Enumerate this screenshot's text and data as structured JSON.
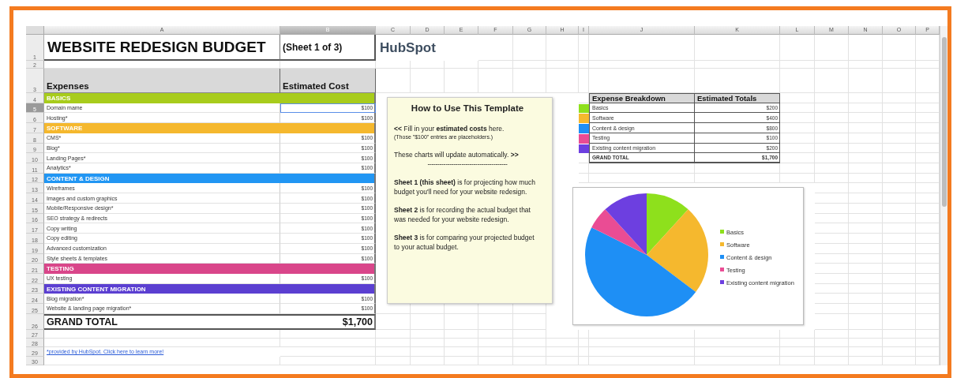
{
  "columns": [
    "A",
    "B",
    "C",
    "D",
    "E",
    "F",
    "G",
    "H",
    "I",
    "J",
    "K",
    "L",
    "M",
    "N",
    "O",
    "P"
  ],
  "row_numbers": [
    "1",
    "2",
    "3",
    "4",
    "5",
    "6",
    "7",
    "8",
    "9",
    "10",
    "11",
    "12",
    "13",
    "14",
    "15",
    "16",
    "17",
    "18",
    "19",
    "20",
    "21",
    "22",
    "23",
    "24",
    "25",
    "26",
    "27",
    "28",
    "29",
    "30"
  ],
  "title": "WEBSITE REDESIGN BUDGET",
  "sheet_label": "(Sheet 1 of 3)",
  "logo": "HubSpot",
  "headers": [
    "Expenses",
    "Estimated Cost"
  ],
  "sections": [
    {
      "name": "BASICS",
      "color": "#a8cc1c",
      "items": [
        {
          "label": "Domain mame",
          "cost": "$100",
          "selected": true
        },
        {
          "label": "Hosting*",
          "cost": "$100",
          "selected": false
        }
      ]
    },
    {
      "name": "SOFTWARE",
      "color": "#f5b82e",
      "items": [
        {
          "label": "CMS*",
          "cost": "$100",
          "selected": false
        },
        {
          "label": "Blog*",
          "cost": "$100",
          "selected": false
        },
        {
          "label": "Landing Pages*",
          "cost": "$100",
          "selected": false
        },
        {
          "label": "Analytics*",
          "cost": "$100",
          "selected": false
        }
      ]
    },
    {
      "name": "CONTENT & DESIGN",
      "color": "#2196f3",
      "items": [
        {
          "label": "Wireframes",
          "cost": "$100",
          "selected": false
        },
        {
          "label": "Images and custom graphics",
          "cost": "$100",
          "selected": false
        },
        {
          "label": "Mobile/Responsive design*",
          "cost": "$100",
          "selected": false
        },
        {
          "label": "SEO strategy & redirects",
          "cost": "$100",
          "selected": false
        },
        {
          "label": "Copy writing",
          "cost": "$100",
          "selected": false
        },
        {
          "label": "Copy editing",
          "cost": "$100",
          "selected": false
        },
        {
          "label": "Advanced customization",
          "cost": "$100",
          "selected": false
        },
        {
          "label": "Style sheets & templates",
          "cost": "$100",
          "selected": false
        }
      ]
    },
    {
      "name": "TESTING",
      "color": "#d9468a",
      "items": [
        {
          "label": "UX testing",
          "cost": "$100",
          "selected": false
        }
      ]
    },
    {
      "name": "EXISTING CONTENT MIGRATION",
      "color": "#5b3fd1",
      "items": [
        {
          "label": "Blog migration*",
          "cost": "$100",
          "selected": false
        },
        {
          "label": "Website & landing page migration*",
          "cost": "$100",
          "selected": false
        }
      ]
    }
  ],
  "grand_total": {
    "label": "GRAND TOTAL",
    "value": "$1,700"
  },
  "link": "*provided by HubSpot. Click here to learn more!",
  "note": {
    "title": "How to Use This Template",
    "paragraphs": [
      {
        "kind": "body",
        "text": "**<<** Fill in your **estimated costs** here."
      },
      {
        "kind": "small",
        "text": "(Those \"$100\" entries are placeholders.)"
      },
      {
        "kind": "body",
        "text": "These charts will update automatically. **>>**"
      },
      {
        "kind": "rule",
        "text": "----------------------------------------"
      },
      {
        "kind": "body",
        "text": "**Sheet 1 (this sheet)** is for projecting how much budget you'll need for your website redesign."
      },
      {
        "kind": "body",
        "text": "**Sheet 2** is for recording the actual budget that was needed for your website redesign."
      },
      {
        "kind": "body",
        "text": "**Sheet 3** is for comparing your projected budget to your actual budget."
      }
    ]
  },
  "breakdown": {
    "headers": [
      "Expense Breakdown",
      "Estimated Totals"
    ],
    "rows": [
      {
        "name": "Basics",
        "total": "$200",
        "color": "#8ee01c"
      },
      {
        "name": "Software",
        "total": "$400",
        "color": "#f5b82e"
      },
      {
        "name": "Content & design",
        "total": "$800",
        "color": "#1e8ff5"
      },
      {
        "name": "Testing",
        "total": "$100",
        "color": "#ea4c94"
      },
      {
        "name": "Existing content migration",
        "total": "$200",
        "color": "#6d3fe0"
      }
    ],
    "total": {
      "label": "GRAND TOTAL",
      "value": "$1,700"
    }
  },
  "chart": {
    "chart_data": {
      "type": "pie",
      "categories": [
        "Basics",
        "Software",
        "Content & design",
        "Testing",
        "Existing content migration"
      ],
      "values": [
        11.77,
        23.53,
        47.06,
        5.88,
        11.76
      ],
      "legend": true
    }
  }
}
